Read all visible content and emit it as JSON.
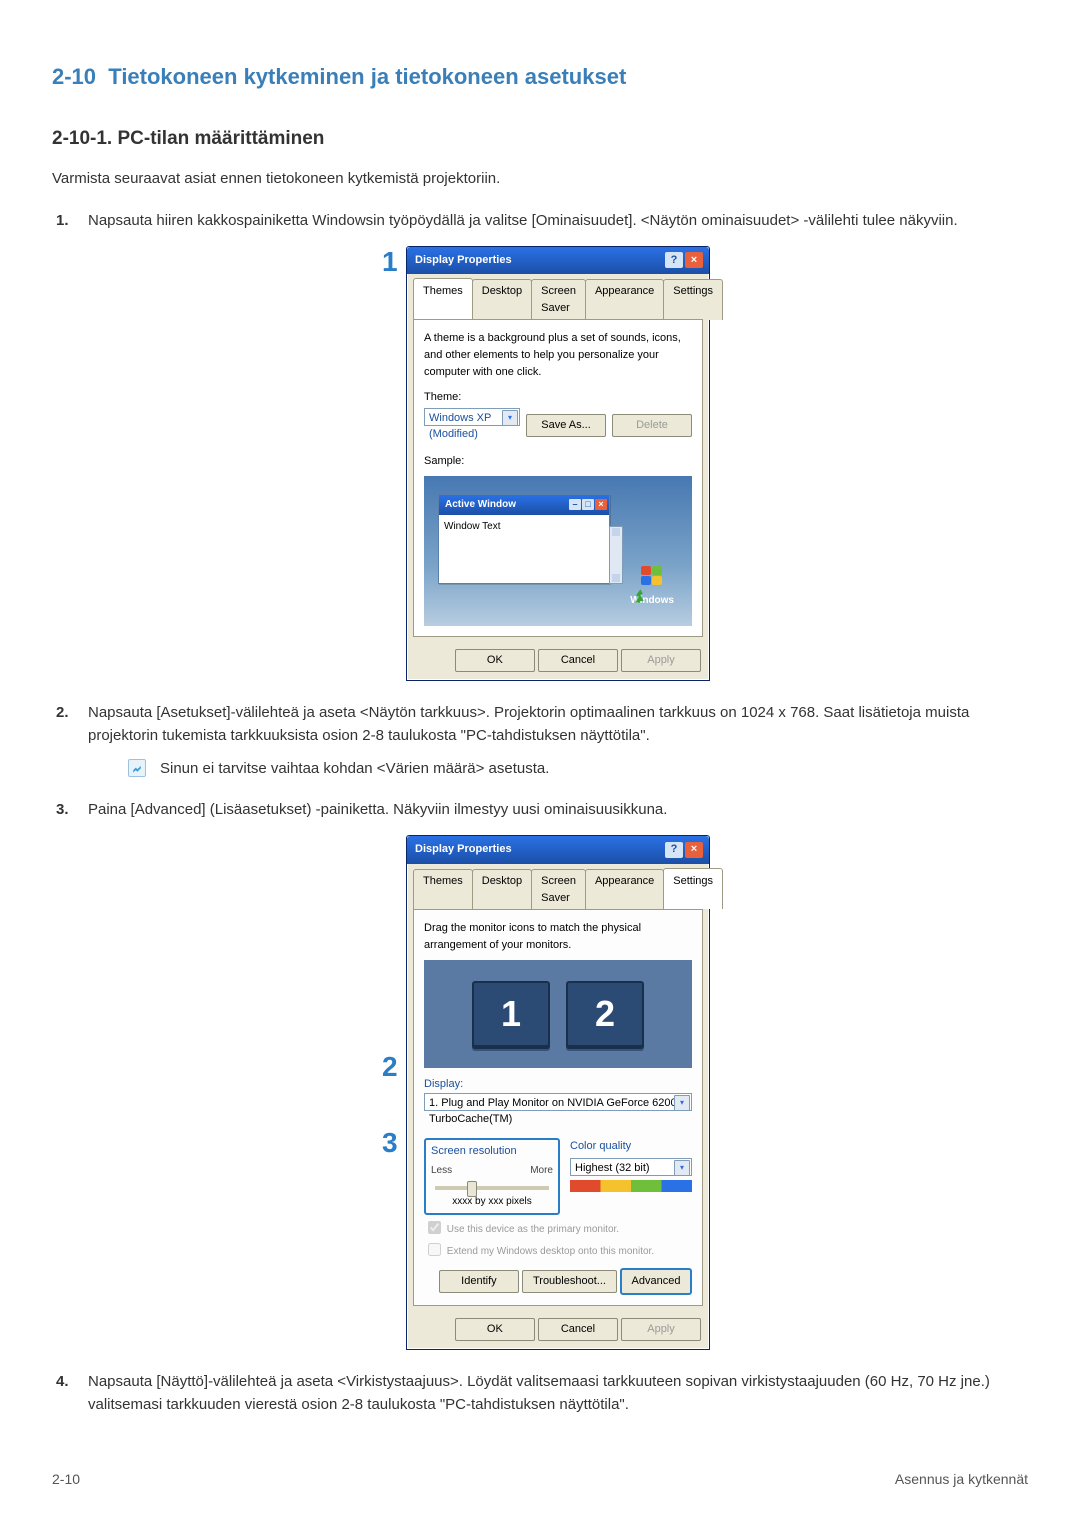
{
  "header": {
    "section": "2-10",
    "title": "Tietokoneen kytkeminen ja tietokoneen asetukset"
  },
  "subsection": "2-10-1. PC-tilan määrittäminen",
  "intro": "Varmista seuraavat asiat ennen tietokoneen kytkemistä projektoriin.",
  "steps": {
    "s1": "Napsauta hiiren kakkospainiketta Windowsin työpöydällä ja valitse [Ominaisuudet]. <Näytön ominaisuudet> -välilehti tulee näkyviin.",
    "s2": "Napsauta [Asetukset]-välilehteä ja aseta <Näytön tarkkuus>. Projektorin optimaalinen tarkkuus on 1024 x 768. Saat lisätietoja muista projektorin tukemista tarkkuuksista osion 2-8 taulukosta \"PC-tahdistuksen näyttötila\".",
    "note_after_2": "Sinun ei tarvitse vaihtaa kohdan <Värien määrä> asetusta.",
    "s3": "Paina [Advanced] (Lisäasetukset) -painiketta. Näkyviin ilmestyy uusi ominaisuusikkuna.",
    "s4": "Napsauta [Näyttö]-välilehteä ja aseta <Virkistystaajuus>. Löydät valitsemaasi tarkkuuteen sopivan virkistystaajuuden (60 Hz, 70 Hz jne.) valitsemasi tarkkuuden vierestä osion 2-8 taulukosta \"PC-tahdistuksen näyttötila\"."
  },
  "callouts": {
    "c1": "1",
    "c2": "2",
    "c3": "3"
  },
  "dialog1": {
    "title": "Display Properties",
    "tabs": {
      "themes": "Themes",
      "desktop": "Desktop",
      "saver": "Screen Saver",
      "appearance": "Appearance",
      "settings": "Settings"
    },
    "desc": "A theme is a background plus a set of sounds, icons, and other elements to help you personalize your computer with one click.",
    "theme_label": "Theme:",
    "theme_value": "Windows XP (Modified)",
    "save_as": "Save As...",
    "delete": "Delete",
    "sample_label": "Sample:",
    "sample_win_title": "Active Window",
    "sample_win_text": "Window Text",
    "logo_text": "Windows",
    "ok": "OK",
    "cancel": "Cancel",
    "apply": "Apply"
  },
  "dialog2": {
    "title": "Display Properties",
    "desc": "Drag the monitor icons to match the physical arrangement of your monitors.",
    "display_label": "Display:",
    "display_value": "1. Plug and Play Monitor on NVIDIA GeForce 6200 TurboCache(TM)",
    "res_hdr": "Screen resolution",
    "less": "Less",
    "more": "More",
    "px_text": "xxxx by xxx pixels",
    "color_hdr": "Color quality",
    "color_value": "Highest (32 bit)",
    "chk1": "Use this device as the primary monitor.",
    "chk2": "Extend my Windows desktop onto this monitor.",
    "identify": "Identify",
    "troubleshoot": "Troubleshoot...",
    "advanced": "Advanced",
    "ok": "OK",
    "cancel": "Cancel",
    "apply": "Apply",
    "mon1": "1",
    "mon2": "2"
  },
  "footer": {
    "left": "2-10",
    "right": "Asennus ja kytkennät"
  }
}
